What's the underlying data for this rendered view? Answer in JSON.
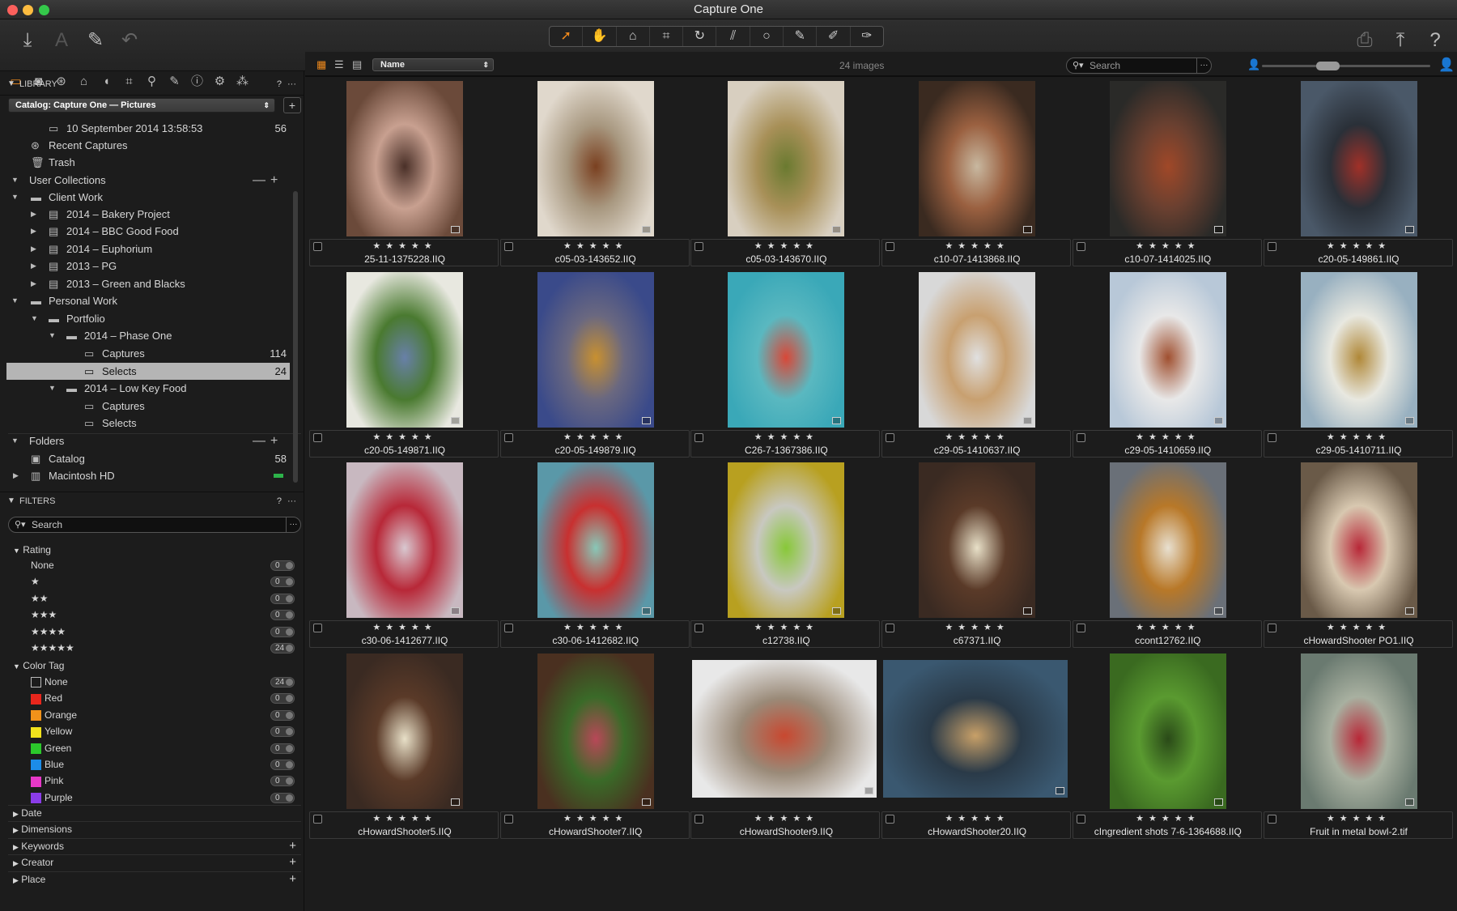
{
  "window": {
    "title": "Capture One"
  },
  "toolbar": {
    "left_icons": [
      "import-icon",
      "text-icon",
      "brush-icon",
      "undo-icon"
    ],
    "cursor_tools": [
      "select-icon",
      "pan-icon",
      "loupe-icon",
      "crop-icon",
      "rotate-icon",
      "keystone-icon",
      "spot-icon",
      "brush-icon",
      "eraser-icon",
      "color-picker-icon"
    ],
    "right_icons": [
      "print-icon",
      "export-icon",
      "help-icon"
    ],
    "help_label": "?"
  },
  "library": {
    "header": "LIBRARY",
    "help": "?",
    "more": "···",
    "catalog_select": "Catalog: Capture One — Pictures",
    "add_label": "+",
    "items": [
      {
        "label": "10 September 2014 13:58:53",
        "count": "56"
      },
      {
        "label": "Recent Captures",
        "count": ""
      },
      {
        "label": "Trash",
        "count": ""
      }
    ],
    "user_collections": "User Collections",
    "tree": [
      {
        "label": "Client Work"
      },
      {
        "label": "2014 – Bakery Project"
      },
      {
        "label": "2014 – BBC Good Food"
      },
      {
        "label": "2014 – Euphorium"
      },
      {
        "label": "2013 – PG"
      },
      {
        "label": "2013 – Green and Blacks"
      },
      {
        "label": "Personal Work"
      },
      {
        "label": "Portfolio"
      },
      {
        "label": "2014 – Phase One"
      },
      {
        "label": "Captures",
        "count": "114"
      },
      {
        "label": "Selects",
        "count": "24"
      },
      {
        "label": "2014 – Low Key Food"
      },
      {
        "label": "Captures",
        "count": ""
      },
      {
        "label": "Selects",
        "count": ""
      }
    ],
    "folders_label": "Folders",
    "folders": [
      {
        "label": "Catalog",
        "count": "58"
      },
      {
        "label": "Macintosh HD",
        "count": ""
      }
    ],
    "minus": "—",
    "plus": "+"
  },
  "filters": {
    "header": "FILTERS",
    "help": "?",
    "more": "···",
    "search_placeholder": "Search",
    "rating_label": "Rating",
    "ratings": [
      {
        "label": "None",
        "count": "0"
      },
      {
        "label": "★",
        "count": "0"
      },
      {
        "label": "★★",
        "count": "0"
      },
      {
        "label": "★★★",
        "count": "0"
      },
      {
        "label": "★★★★",
        "count": "0"
      },
      {
        "label": "★★★★★",
        "count": "24"
      }
    ],
    "color_tag_label": "Color Tag",
    "color_tags": [
      {
        "label": "None",
        "count": "24",
        "color": "#1c1c1c"
      },
      {
        "label": "Red",
        "count": "0",
        "color": "#e8261c"
      },
      {
        "label": "Orange",
        "count": "0",
        "color": "#f2921a"
      },
      {
        "label": "Yellow",
        "count": "0",
        "color": "#f2e21c"
      },
      {
        "label": "Green",
        "count": "0",
        "color": "#2bc82b"
      },
      {
        "label": "Blue",
        "count": "0",
        "color": "#1c8ce8"
      },
      {
        "label": "Pink",
        "count": "0",
        "color": "#e838c8"
      },
      {
        "label": "Purple",
        "count": "0",
        "color": "#8a3ce8"
      }
    ],
    "collapsed": [
      "Date",
      "Dimensions",
      "Keywords",
      "Creator",
      "Place"
    ]
  },
  "browser": {
    "sort_label": "Name",
    "image_count": "24 images",
    "search_placeholder": "Search",
    "thumbnail_size_fraction": 0.38,
    "stars": "★★★★★",
    "images": [
      {
        "name": "25-11-1375228.IIQ",
        "colors": [
          "#6b4a3a",
          "#c8a090",
          "#4a3028"
        ]
      },
      {
        "name": "c05-03-143652.IIQ",
        "colors": [
          "#e0d8cc",
          "#a89880",
          "#7a4020"
        ]
      },
      {
        "name": "c05-03-143670.IIQ",
        "colors": [
          "#d8cfc0",
          "#a89058",
          "#6a7a30"
        ]
      },
      {
        "name": "c10-07-1413868.IIQ",
        "colors": [
          "#3a2a20",
          "#9a6040",
          "#c8b8a0"
        ]
      },
      {
        "name": "c10-07-1414025.IIQ",
        "colors": [
          "#2a2a28",
          "#6a4030",
          "#a04828"
        ]
      },
      {
        "name": "c20-05-149861.IIQ",
        "colors": [
          "#4a5868",
          "#2a3038",
          "#a03028"
        ]
      },
      {
        "name": "c20-05-149871.IIQ",
        "colors": [
          "#e8e8e0",
          "#4a7a30",
          "#6880a8"
        ]
      },
      {
        "name": "c20-05-149879.IIQ",
        "colors": [
          "#3a4a8a",
          "#6a6880",
          "#c89030"
        ]
      },
      {
        "name": "C26-7-1367386.IIQ",
        "colors": [
          "#3aa8b8",
          "#5ab8c0",
          "#d84838"
        ]
      },
      {
        "name": "c29-05-1410637.IIQ",
        "colors": [
          "#d8d8d8",
          "#c8a070",
          "#e0e0e0"
        ]
      },
      {
        "name": "c29-05-1410659.IIQ",
        "colors": [
          "#b8c8d8",
          "#e8e8e8",
          "#a05030"
        ]
      },
      {
        "name": "c29-05-1410711.IIQ",
        "colors": [
          "#98b0c0",
          "#e8e8e0",
          "#b08838"
        ]
      },
      {
        "name": "c30-06-1412677.IIQ",
        "colors": [
          "#c8b8c0",
          "#b82838",
          "#d8c8d0"
        ]
      },
      {
        "name": "c30-06-1412682.IIQ",
        "colors": [
          "#5a98a8",
          "#c83030",
          "#88c8b8"
        ]
      },
      {
        "name": "c12738.IIQ",
        "colors": [
          "#b8a020",
          "#c8c8c0",
          "#88c838"
        ]
      },
      {
        "name": "c67371.IIQ",
        "colors": [
          "#3a2a22",
          "#5a3a28",
          "#e8e0c8"
        ]
      },
      {
        "name": "ccont12762.IIQ",
        "colors": [
          "#6a7078",
          "#b87828",
          "#e8e0d0"
        ]
      },
      {
        "name": "cHowardShooter PO1.IIQ",
        "colors": [
          "#6a5a48",
          "#d8c8b0",
          "#b82838"
        ]
      },
      {
        "name": "cHowardShooter5.IIQ",
        "colors": [
          "#3a2a22",
          "#5a3a28",
          "#e8e0c8"
        ]
      },
      {
        "name": "cHowardShooter7.IIQ",
        "colors": [
          "#4a3020",
          "#3a6a28",
          "#b84858"
        ]
      },
      {
        "name": "cHowardShooter9.IIQ",
        "colors": [
          "#e8e8e8",
          "#9a8a78",
          "#c84830"
        ]
      },
      {
        "name": "cHowardShooter20.IIQ",
        "colors": [
          "#3a5870",
          "#2a3a48",
          "#c8a068"
        ]
      },
      {
        "name": "cIngredient shots 7-6-1364688.IIQ",
        "colors": [
          "#3a6a20",
          "#5a9a30",
          "#2a4a18"
        ]
      },
      {
        "name": "Fruit in metal bowl-2.tif",
        "colors": [
          "#6a7a70",
          "#a8b0a0",
          "#b82838"
        ]
      }
    ]
  }
}
